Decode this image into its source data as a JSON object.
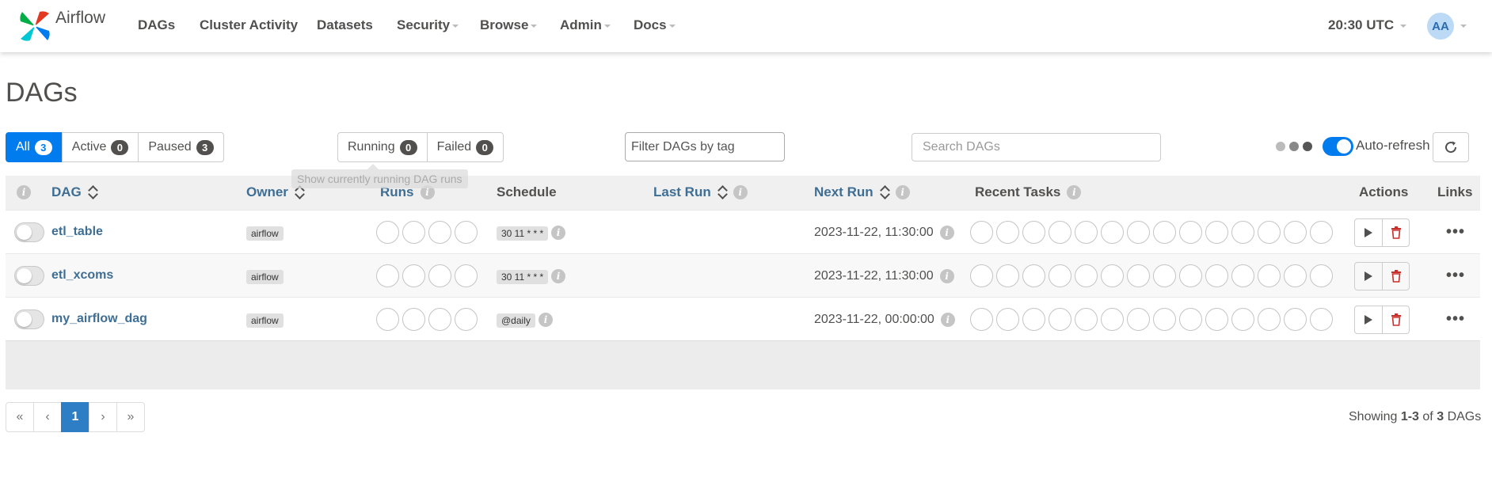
{
  "navbar": {
    "brand": "Airflow",
    "items": [
      {
        "label": "DAGs",
        "dropdown": false
      },
      {
        "label": "Cluster Activity",
        "dropdown": false
      },
      {
        "label": "Datasets",
        "dropdown": false
      },
      {
        "label": "Security",
        "dropdown": true
      },
      {
        "label": "Browse",
        "dropdown": true
      },
      {
        "label": "Admin",
        "dropdown": true
      },
      {
        "label": "Docs",
        "dropdown": true
      }
    ],
    "clock": "20:30 UTC",
    "avatar_initials": "AA"
  },
  "page": {
    "title": "DAGs"
  },
  "filters": {
    "status": [
      {
        "label": "All",
        "count": "3",
        "active": true
      },
      {
        "label": "Active",
        "count": "0",
        "active": false
      },
      {
        "label": "Paused",
        "count": "3",
        "active": false
      }
    ],
    "runs": [
      {
        "label": "Running",
        "count": "0"
      },
      {
        "label": "Failed",
        "count": "0"
      }
    ],
    "tag_placeholder": "Filter DAGs by tag",
    "search_placeholder": "Search DAGs",
    "autorefresh_label": "Auto-refresh",
    "autorefresh_on": true,
    "tooltip": "Show currently running DAG runs"
  },
  "table": {
    "headers": {
      "dag": "DAG",
      "owner": "Owner",
      "runs": "Runs",
      "schedule": "Schedule",
      "last_run": "Last Run",
      "next_run": "Next Run",
      "recent_tasks": "Recent Tasks",
      "actions": "Actions",
      "links": "Links"
    },
    "rows": [
      {
        "dag_id": "etl_table",
        "owner": "airflow",
        "schedule": "30 11 * * *",
        "last_run": "",
        "next_run": "2023-11-22, 11:30:00",
        "paused": true
      },
      {
        "dag_id": "etl_xcoms",
        "owner": "airflow",
        "schedule": "30 11 * * *",
        "last_run": "",
        "next_run": "2023-11-22, 11:30:00",
        "paused": true
      },
      {
        "dag_id": "my_airflow_dag",
        "owner": "airflow",
        "schedule": "@daily",
        "last_run": "",
        "next_run": "2023-11-22, 00:00:00",
        "paused": true
      }
    ],
    "run_circle_count": 4,
    "task_circle_count": 14
  },
  "pagination": {
    "first": "«",
    "prev": "‹",
    "current": "1",
    "next": "›",
    "last": "»"
  },
  "footer": {
    "showing_prefix": "Showing",
    "range": "1-3",
    "of": "of",
    "total": "3",
    "suffix": "DAGs"
  },
  "colors": {
    "primary": "#017cee",
    "link": "#3e6e94",
    "text": "#51504f",
    "delete": "#c9302c"
  },
  "icons": {
    "dots": [
      "#bbbbbb",
      "#888888",
      "#555555"
    ]
  }
}
